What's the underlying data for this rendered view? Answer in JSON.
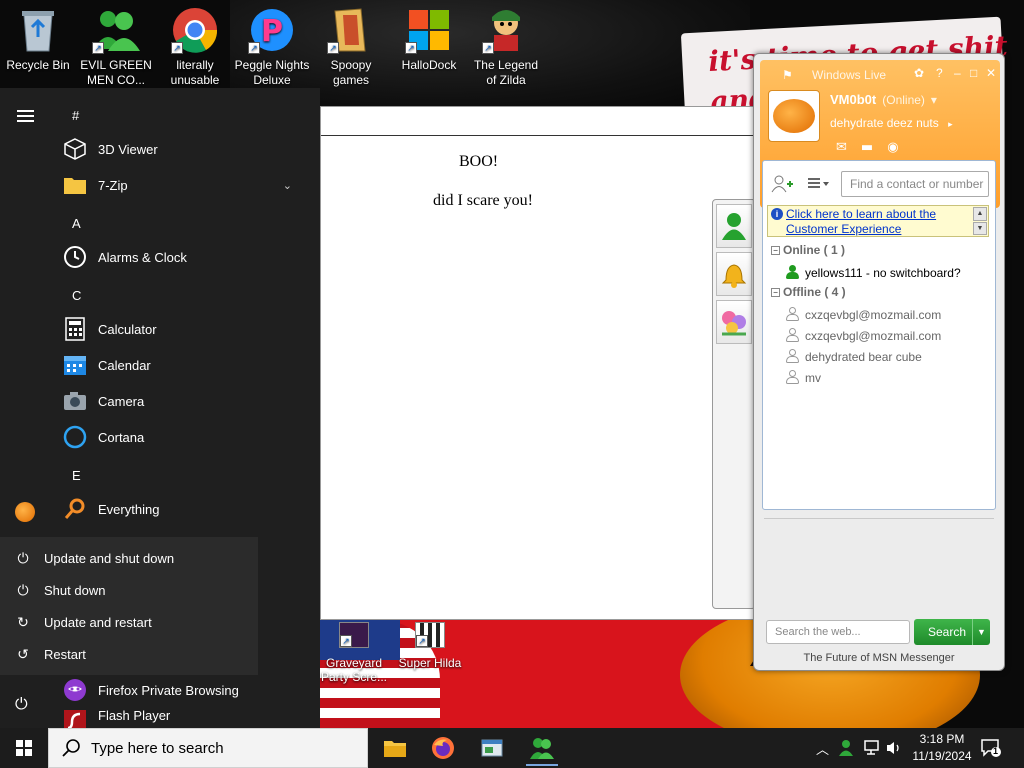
{
  "desktop": {
    "sign_text_line1": "it's time to get shit",
    "sign_text_line2": "and",
    "icons": [
      {
        "label": "Recycle Bin",
        "icon": "recycle-bin-icon"
      },
      {
        "label": "EVIL GREEN MEN CO...",
        "icon": "green-men-icon"
      },
      {
        "label": "literally unusable",
        "icon": "chrome-icon"
      },
      {
        "label": "Peggle Nights Deluxe",
        "icon": "peggle-icon"
      },
      {
        "label": "Spoopy games",
        "icon": "folder-icon"
      },
      {
        "label": "HalloDock",
        "icon": "windows-logo-icon"
      },
      {
        "label": "The Legend of Zilda",
        "icon": "zilda-icon"
      }
    ],
    "lower_icons": [
      {
        "label": "Graveyard Party Scre...",
        "icon": "graveyard-icon"
      },
      {
        "label": "Super Hilda",
        "icon": "super-hilda-icon"
      }
    ]
  },
  "document": {
    "line1": "BOO!",
    "line2": "did I scare you!"
  },
  "msn": {
    "title": "Windows Live",
    "display_name": "VM0b0t",
    "status": "(Online)",
    "personal_message": "dehydrate deez nuts",
    "find_placeholder": "Find a contact or number",
    "info_link": "Click here to learn about the Customer Experience",
    "online_group": "Online ( 1 )",
    "offline_group": "Offline ( 4 )",
    "online_contacts": [
      "yellows111 - no switchboard?"
    ],
    "offline_contacts": [
      "cxzqevbgl@mozmail.com",
      "cxzqevbgl@mozmail.com",
      "dehydrated bear cube",
      "mv"
    ],
    "web_search_placeholder": "Search the web...",
    "search_button": "Search",
    "footer": "The Future of MSN Messenger"
  },
  "start_menu": {
    "sections": {
      "hash": "#",
      "a": "A",
      "c": "C",
      "e": "E"
    },
    "apps": {
      "viewer3d": "3D Viewer",
      "zip": "7-Zip",
      "alarms": "Alarms & Clock",
      "calculator": "Calculator",
      "calendar": "Calendar",
      "camera": "Camera",
      "cortana": "Cortana",
      "everything": "Everything",
      "firefox_private": "Firefox Private Browsing",
      "flash": "Flash Player"
    },
    "power_menu": [
      "Update and shut down",
      "Shut down",
      "Update and restart",
      "Restart"
    ]
  },
  "taskbar": {
    "search_placeholder": "Type here to search",
    "time": "3:18 PM",
    "date": "11/19/2024",
    "notification_count": "1"
  }
}
